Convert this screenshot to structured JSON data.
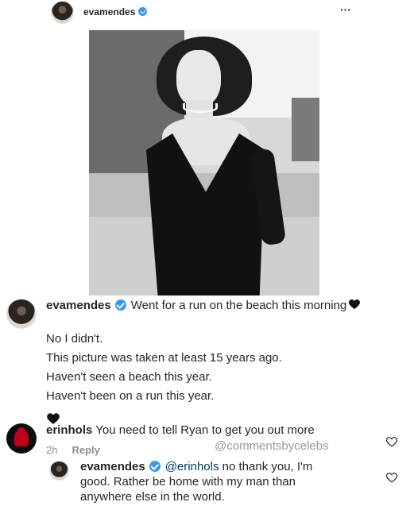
{
  "post": {
    "username": "evamendes",
    "more_label": "···"
  },
  "caption": {
    "username": "evamendes",
    "text": "Went for a run on the beach this morning",
    "lines": [
      "No I didn't.",
      "This picture was taken at least 15 years ago.",
      "Haven't seen a beach this year.",
      "Haven't been on a run this year."
    ]
  },
  "comments": [
    {
      "username": "erinhols",
      "text": "You need to tell Ryan to get you out more",
      "time": "2h",
      "reply_label": "Reply"
    }
  ],
  "reply": {
    "username": "evamendes",
    "mention": "@erinhols",
    "text": " no thank you, I'm good. Rather be home with my man than anywhere else in the world."
  },
  "watermark": "@commentsbycelebs",
  "colors": {
    "verified": "#3897f0",
    "text": "#262626",
    "muted": "#8e8e8e",
    "mention": "#003569"
  },
  "icons": [
    "verified-badge-icon",
    "more-options-icon",
    "black-heart-emoji-icon",
    "heart-outline-icon"
  ]
}
